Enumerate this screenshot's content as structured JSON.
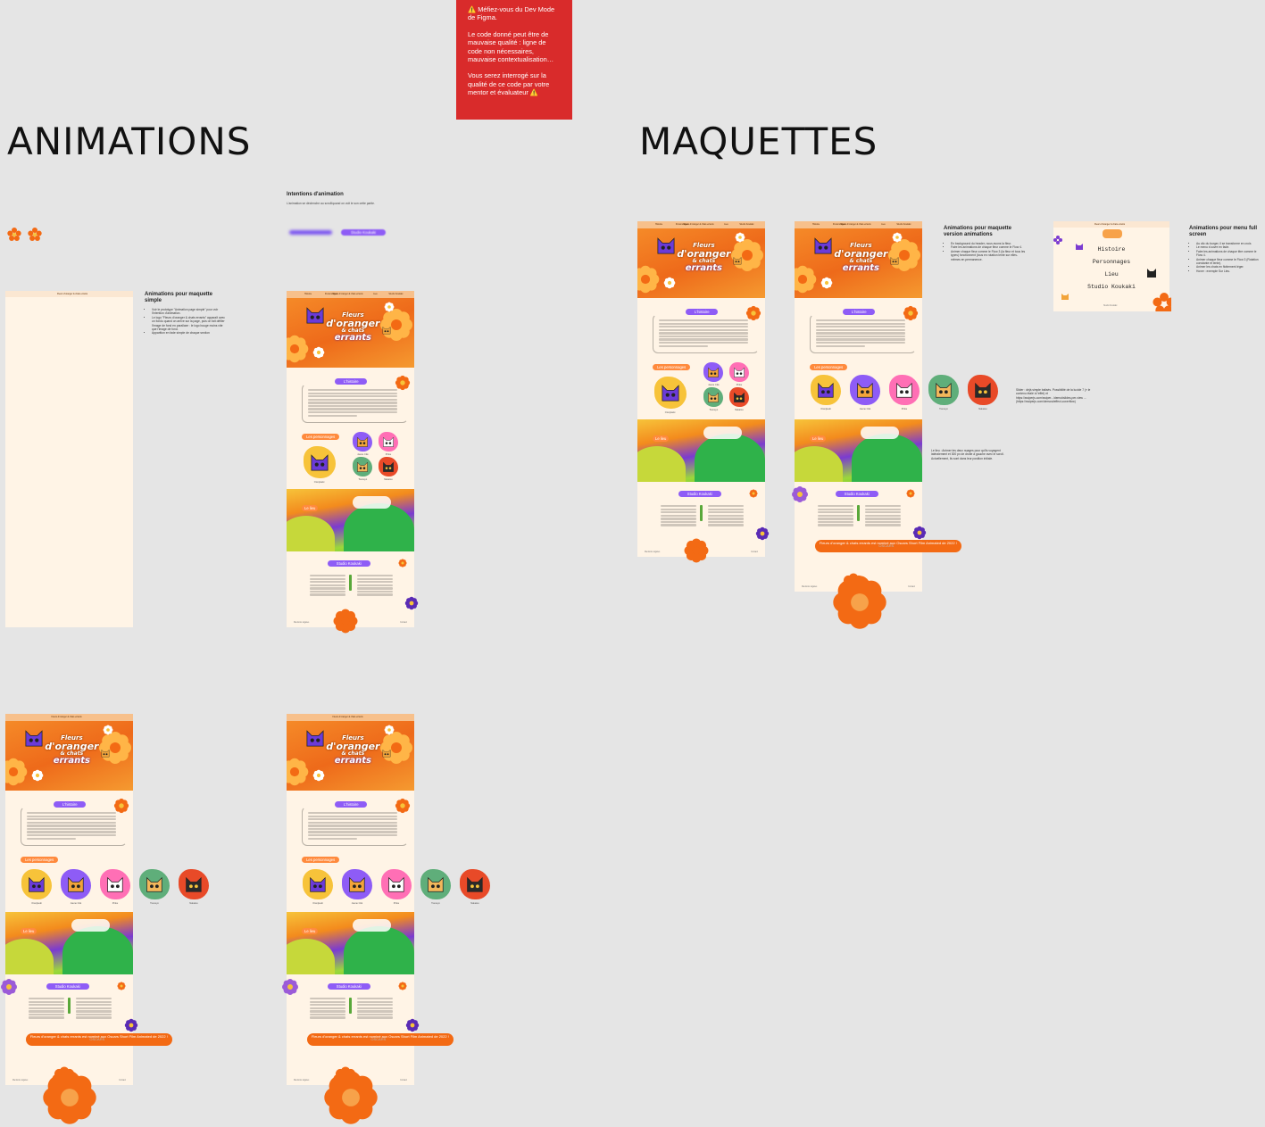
{
  "warning": {
    "line1": "⚠️ Méfiez-vous du Dev Mode de Figma.",
    "line2": "Le code donné peut être de mauvaise qualité : ligne de code non nécessaires, mauvaise contextualisation…",
    "line3": "Vous serez interrogé sur la qualité de ce code par votre mentor et évaluateur ⚠️"
  },
  "sections": {
    "animations": "ANIMATIONS",
    "maquettes": "MAQUETTES"
  },
  "intentions": {
    "title": "Intentions d'animation",
    "subtitle": "L'animation se déclenche au scroll/quand on voit le son cette partie.",
    "studio_tag": "Studio Koukaki"
  },
  "notes": {
    "simple": {
      "title": "Animations pour maquette simple",
      "items": [
        "Voir le prototype \"Animation page simple\" pour voir l'intention d'animation.",
        "Le logo \"Fleurs d'oranger & chats errants\" apparaît avec un fondu quand on arrive sur la page, puis on fait défiler l'image de fond en parallaxe : le logo bouge moins vite que l'image de fond.",
        "Apparition en fade simple de chaque section"
      ]
    },
    "version": {
      "title": "Animations pour maquette version animations",
      "items": [
        "En background du header, nous avons la fleur.",
        "Faire les animations de chaque fleur comme le Flow 4.",
        "Animer chaque fleur comme le Flow 3 (la fleur et tous les types) fonctionnent (tous en rotation lente sur elles-mêmes en permanence."
      ]
    },
    "slider": "Slider : déjà simple balisés. Possibilité de la lucide 7 (« le contenu étalé à l'effet) et https://swiperjs.com/swiper.../demo#slides-per-view ... (https://swiperjs.com/demos#effect-coverflow)",
    "lieu": "Le lieu : Animer les deux nuages pour qu'ils voyagent latéralement et 300 px de droite à gauche avec le scroll. Actuellement, ils sont dans leur position initiale.",
    "menu": {
      "title": "Animations pour menu full screen",
      "items": [
        "Au clic du burger, il se transforme en croix.",
        "Le menu s'ouvre en fade.",
        "Faire les animations de chaque titre comme le Flow 4.",
        "Animer chaque fleur comme le Flow 3 (Rotation constante et lente).",
        "Animer les chats en flottement léger.",
        "Hover : exemple Sur Lieu."
      ]
    }
  },
  "mockup": {
    "nav_title": "Fleurs d'oranger & chats errants",
    "nav_items": [
      "Histoire",
      "Personnages",
      "Lieu",
      "Studio Koukaki"
    ],
    "hero": {
      "line1": "Fleurs",
      "line2": "d'oranger",
      "line3": "& chats",
      "line4": "errants"
    },
    "histoire": "L'histoire",
    "personnages": "Les personnages",
    "lieu": "Le lieu",
    "studio": "Studio Koukaki",
    "cats": [
      "Orenjiseki",
      "Jaune Cité",
      "Pinku",
      "Tsuneyo",
      "Nakatsu"
    ],
    "oscar": "Fleurs d'oranger & chats errants est nominé aux Oscars Short Film Animated de 2022 !",
    "oscar_badge": "OSCARS",
    "footer_left": "Mentions légales",
    "footer_right": "Contact"
  },
  "menu_frame": {
    "items": [
      "Histoire",
      "Personnages",
      "Lieu",
      "Studio Koukaki"
    ],
    "footer": "Studio Koukaki"
  },
  "colors": {
    "background": "#e5e5e5",
    "warning": "#d92b2b",
    "page_bg": "#fff4e6",
    "violet": "#8e5cf6",
    "orange": "#f36a14"
  }
}
